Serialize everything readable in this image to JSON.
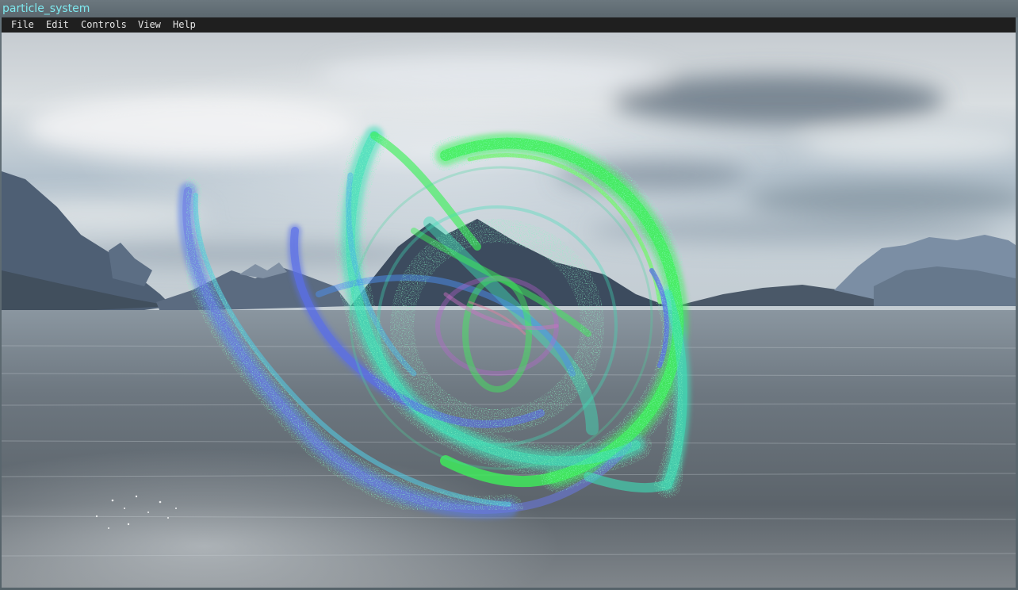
{
  "window": {
    "title": "particle_system"
  },
  "menubar": {
    "items": [
      {
        "label": "File"
      },
      {
        "label": "Edit"
      },
      {
        "label": "Controls"
      },
      {
        "label": "View"
      },
      {
        "label": "Help"
      }
    ]
  },
  "colors": {
    "title_text": "#7ee8ee",
    "menubar_bg": "#1f1f1f",
    "menu_text": "#e6e6e6",
    "particle_green": "#3df05a",
    "particle_blue": "#5a6fe8",
    "particle_teal": "#3ee0b8",
    "particle_magenta": "#c060d8"
  }
}
